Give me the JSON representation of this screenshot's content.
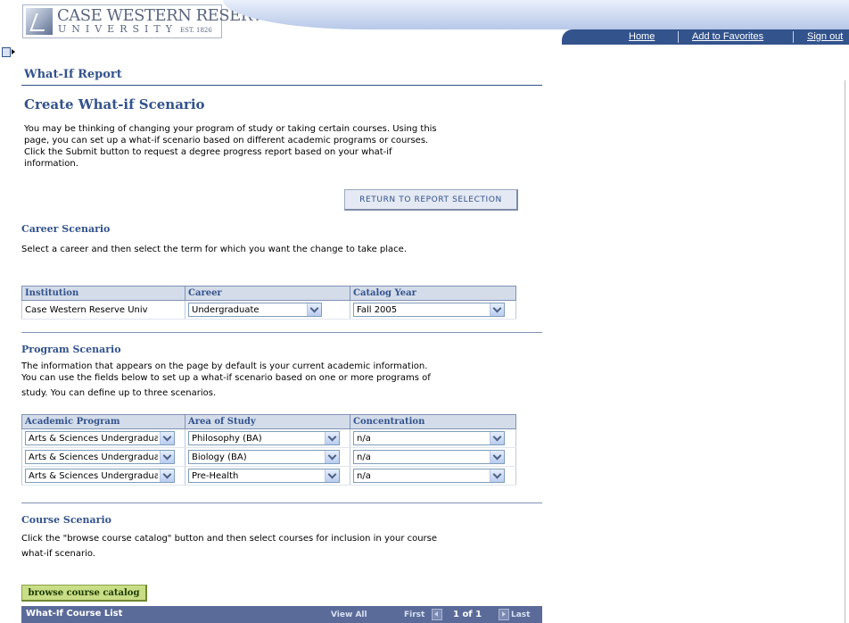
{
  "header": {
    "logo_line1": "CASE WESTERN RESERVE",
    "logo_line2": "UNIVERSITY",
    "logo_est": "EST. 1826",
    "nav": {
      "home": "Home",
      "favorites": "Add to Favorites",
      "signout": "Sign out"
    },
    "menu_toggle_icon": "menu-toggle-icon"
  },
  "page": {
    "title": "What-If Report",
    "heading": "Create What-if Scenario",
    "intro": [
      "You may be thinking of changing your program of study or taking certain courses. Using this",
      "page, you can set up a what-if scenario based on different academic programs or courses.",
      "Click the Submit button to request a degree progress report based on your what-if",
      "information."
    ],
    "return_button": "RETURN TO REPORT SELECTION"
  },
  "career": {
    "heading": "Career Scenario",
    "instructions": "Select a career and then select the term for which you want the change to take place.",
    "columns": [
      "Institution",
      "Career",
      "Catalog Year"
    ],
    "row": {
      "institution": "Case Western Reserve Univ",
      "career": "Undergraduate",
      "catalog_year": "Fall 2005"
    }
  },
  "program": {
    "heading": "Program Scenario",
    "instructions": [
      "The information that appears on the page by default is your current academic information.",
      "You can use the fields below to set up a what-if scenario based on one or more programs of",
      "study. You can define up to three scenarios."
    ],
    "columns": [
      "Academic Program",
      "Area of Study",
      "Concentration"
    ],
    "rows": [
      {
        "program": "Arts & Sciences Undergradua",
        "area": "Philosophy (BA)",
        "concentration": "n/a"
      },
      {
        "program": "Arts & Sciences Undergradua",
        "area": "Biology (BA)",
        "concentration": "n/a"
      },
      {
        "program": "Arts & Sciences Undergradua",
        "area": "Pre-Health",
        "concentration": "n/a"
      }
    ]
  },
  "course": {
    "heading": "Course Scenario",
    "instructions": [
      "Click the \"browse course catalog\" button and then select courses for inclusion in your course",
      "what-if scenario."
    ],
    "browse_button": "browse course catalog",
    "list_title": "What-If Course List",
    "view_all": "View All",
    "first": "First",
    "page_count": "1 of 1",
    "last": "Last"
  },
  "colors": {
    "brand_blue": "#33538c",
    "header_row": "#d4dcea",
    "browse_button": "#c9dd86",
    "course_bar": "#5b6b99"
  }
}
